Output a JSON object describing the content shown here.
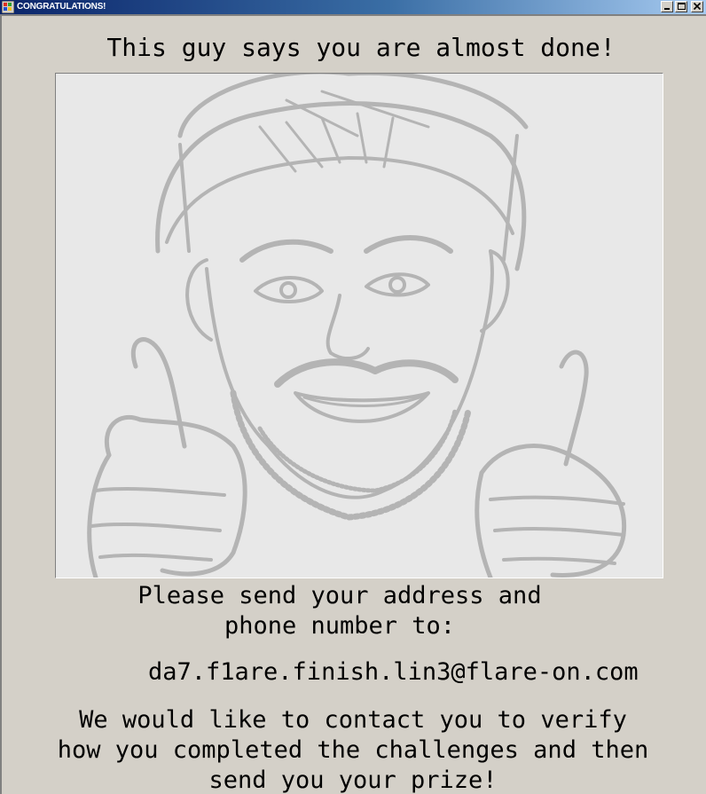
{
  "window": {
    "title": "CONGRATULATIONS!",
    "icon": "windows-app-icon",
    "controls": [
      "minimize-icon",
      "maximize-icon",
      "close-icon"
    ]
  },
  "content": {
    "heading": "This guy says you are almost done!",
    "image_description_icon": "thumbs-up-sketch",
    "instructions": "Please send your address and\nphone number to:",
    "email": "da7.f1are.finish.lin3@flare-on.com",
    "contact_text": "We would like to contact you to verify\nhow you completed the challenges and then\nsend you your prize!"
  },
  "colors": {
    "window_bg": "#d4d0c8",
    "titlebar_start": "#0a246a",
    "titlebar_end": "#a6caf0",
    "sketch_bg": "#e8e8e8",
    "sketch_stroke": "#b4b4b4"
  }
}
